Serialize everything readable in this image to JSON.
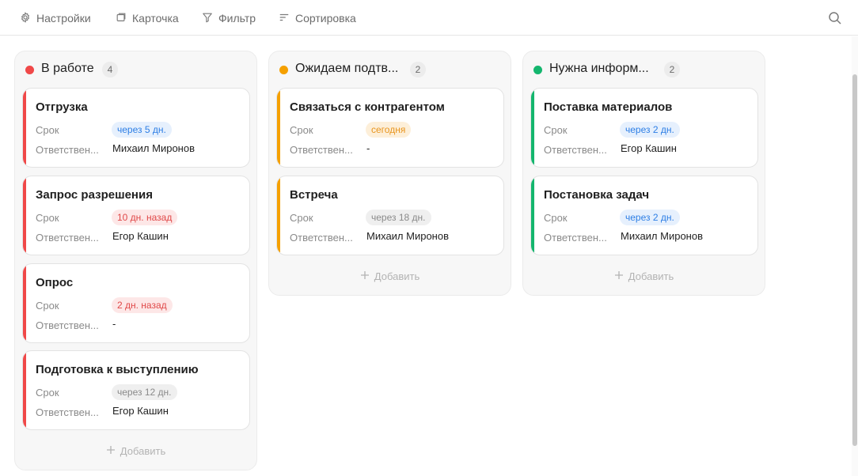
{
  "toolbar": {
    "settings_label": "Настройки",
    "card_label": "Карточка",
    "filter_label": "Фильтр",
    "sort_label": "Сортировка"
  },
  "labels": {
    "due": "Срок",
    "responsible": "Ответствен..."
  },
  "colors": {
    "red": "#f04848",
    "orange": "#f5a000",
    "green": "#14b66e",
    "blue_badge_bg": "#e6f0fd",
    "blue_badge_fg": "#2d7ee5",
    "red_badge_bg": "#fde7e7",
    "red_badge_fg": "#e04848",
    "orange_badge_bg": "#fdefd9",
    "orange_badge_fg": "#e8951e",
    "gray_badge_bg": "#efefef",
    "gray_badge_fg": "#8a8a8a"
  },
  "columns": [
    {
      "title": "В работе",
      "count": "4",
      "color": "red",
      "add_label": "Добавить",
      "cards": [
        {
          "title": "Отгрузка",
          "due": "через 5 дн.",
          "due_style": "blue",
          "responsible": "Михаил Миронов"
        },
        {
          "title": "Запрос разрешения",
          "due": "10 дн. назад",
          "due_style": "red",
          "responsible": "Егор Кашин"
        },
        {
          "title": "Опрос",
          "due": "2 дн. назад",
          "due_style": "red",
          "responsible": "-"
        },
        {
          "title": "Подготовка к выступлению",
          "due": "через 12 дн.",
          "due_style": "gray",
          "responsible": "Егор Кашин"
        }
      ]
    },
    {
      "title": "Ожидаем подтв...",
      "count": "2",
      "color": "orange",
      "add_label": "Добавить",
      "cards": [
        {
          "title": "Связаться с контрагентом",
          "due": "сегодня",
          "due_style": "orange",
          "responsible": "-"
        },
        {
          "title": "Встреча",
          "due": "через 18 дн.",
          "due_style": "gray",
          "responsible": "Михаил Миронов"
        }
      ]
    },
    {
      "title": "Нужна информ...",
      "count": "2",
      "color": "green",
      "add_label": "Добавить",
      "cards": [
        {
          "title": "Поставка материалов",
          "due": "через 2 дн.",
          "due_style": "blue",
          "responsible": "Егор Кашин"
        },
        {
          "title": "Постановка задач",
          "due": "через 2 дн.",
          "due_style": "blue",
          "responsible": "Михаил Миронов"
        }
      ]
    }
  ]
}
